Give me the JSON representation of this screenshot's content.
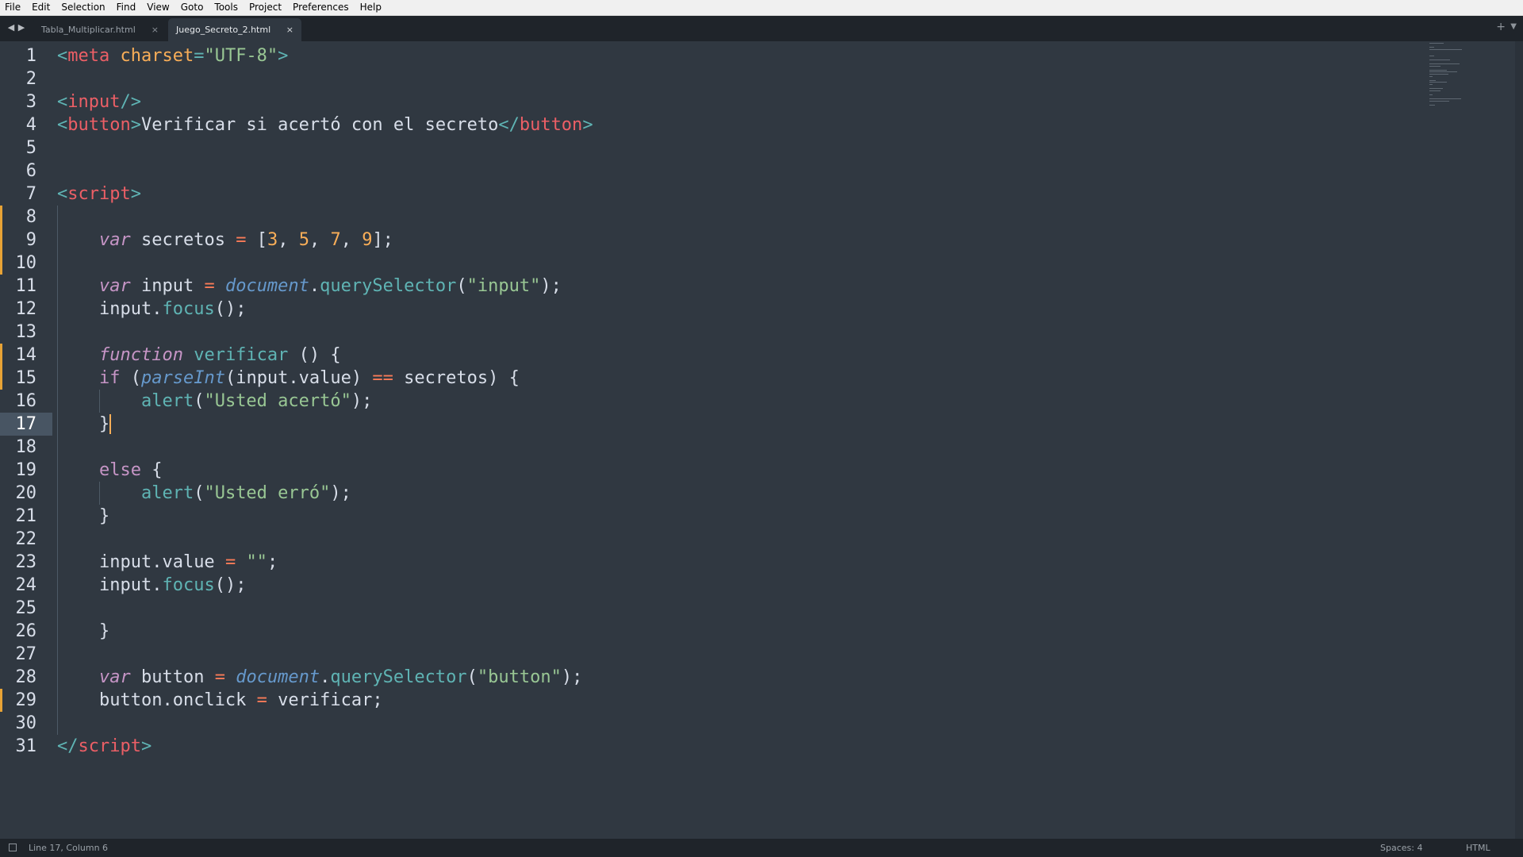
{
  "menu": [
    "File",
    "Edit",
    "Selection",
    "Find",
    "View",
    "Goto",
    "Tools",
    "Project",
    "Preferences",
    "Help"
  ],
  "tabs": [
    {
      "label": "Tabla_Multiplicar.html",
      "active": false
    },
    {
      "label": "Juego_Secreto_2.html",
      "active": true
    }
  ],
  "tab_close_glyph": "×",
  "editor": {
    "current_line": 17,
    "modified_lines": [
      8,
      9,
      10,
      14,
      15,
      29
    ],
    "lines": [
      {
        "n": "1",
        "tokens": [
          [
            "<",
            "punct"
          ],
          [
            "meta",
            "tag"
          ],
          [
            " ",
            "plain"
          ],
          [
            "charset",
            "attr"
          ],
          [
            "=",
            "punct"
          ],
          [
            "\"UTF-8\"",
            "str"
          ],
          [
            ">",
            "punct"
          ]
        ]
      },
      {
        "n": "2",
        "tokens": []
      },
      {
        "n": "3",
        "tokens": [
          [
            "<",
            "punct"
          ],
          [
            "input",
            "tag"
          ],
          [
            "/>",
            "punct"
          ]
        ]
      },
      {
        "n": "4",
        "tokens": [
          [
            "<",
            "punct"
          ],
          [
            "button",
            "tag"
          ],
          [
            ">",
            "punct"
          ],
          [
            "Verificar si acertó con el secreto",
            "text"
          ],
          [
            "</",
            "punct"
          ],
          [
            "button",
            "tag"
          ],
          [
            ">",
            "punct"
          ]
        ]
      },
      {
        "n": "5",
        "tokens": []
      },
      {
        "n": "6",
        "tokens": []
      },
      {
        "n": "7",
        "tokens": [
          [
            "<",
            "punct"
          ],
          [
            "script",
            "tag"
          ],
          [
            ">",
            "punct"
          ]
        ]
      },
      {
        "n": "8",
        "tokens": []
      },
      {
        "n": "9",
        "tokens": [
          [
            "    ",
            "plain"
          ],
          [
            "var",
            "kwi"
          ],
          [
            " secretos ",
            "plain"
          ],
          [
            "=",
            "op"
          ],
          [
            " [",
            "plain"
          ],
          [
            "3",
            "num"
          ],
          [
            ", ",
            "plain"
          ],
          [
            "5",
            "num"
          ],
          [
            ", ",
            "plain"
          ],
          [
            "7",
            "num"
          ],
          [
            ", ",
            "plain"
          ],
          [
            "9",
            "num"
          ],
          [
            "];",
            "plain"
          ]
        ]
      },
      {
        "n": "10",
        "tokens": []
      },
      {
        "n": "11",
        "tokens": [
          [
            "    ",
            "plain"
          ],
          [
            "var",
            "kwi"
          ],
          [
            " input ",
            "plain"
          ],
          [
            "=",
            "op"
          ],
          [
            " ",
            "plain"
          ],
          [
            "document",
            "obj"
          ],
          [
            ".",
            "plain"
          ],
          [
            "querySelector",
            "fn"
          ],
          [
            "(",
            "plain"
          ],
          [
            "\"input\"",
            "str"
          ],
          [
            ");",
            "plain"
          ]
        ]
      },
      {
        "n": "12",
        "tokens": [
          [
            "    ",
            "plain"
          ],
          [
            "input.",
            "plain"
          ],
          [
            "focus",
            "fn"
          ],
          [
            "();",
            "plain"
          ]
        ]
      },
      {
        "n": "13",
        "tokens": []
      },
      {
        "n": "14",
        "tokens": [
          [
            "    ",
            "plain"
          ],
          [
            "function",
            "kwi"
          ],
          [
            " ",
            "plain"
          ],
          [
            "verificar",
            "fn"
          ],
          [
            " () {",
            "plain"
          ]
        ]
      },
      {
        "n": "15",
        "tokens": [
          [
            "    ",
            "plain"
          ],
          [
            "if",
            "kw"
          ],
          [
            " (",
            "plain"
          ],
          [
            "parseInt",
            "obj"
          ],
          [
            "(input.value) ",
            "plain"
          ],
          [
            "==",
            "op"
          ],
          [
            " secretos) {",
            "plain"
          ]
        ]
      },
      {
        "n": "16",
        "tokens": [
          [
            "        ",
            "plain"
          ],
          [
            "alert",
            "fn"
          ],
          [
            "(",
            "plain"
          ],
          [
            "\"Usted acertó\"",
            "str"
          ],
          [
            ");",
            "plain"
          ]
        ]
      },
      {
        "n": "17",
        "tokens": [
          [
            "    }",
            "plain"
          ]
        ]
      },
      {
        "n": "18",
        "tokens": []
      },
      {
        "n": "19",
        "tokens": [
          [
            "    ",
            "plain"
          ],
          [
            "else",
            "kw"
          ],
          [
            " {",
            "plain"
          ]
        ]
      },
      {
        "n": "20",
        "tokens": [
          [
            "        ",
            "plain"
          ],
          [
            "alert",
            "fn"
          ],
          [
            "(",
            "plain"
          ],
          [
            "\"Usted erró\"",
            "str"
          ],
          [
            ");",
            "plain"
          ]
        ]
      },
      {
        "n": "21",
        "tokens": [
          [
            "    }",
            "plain"
          ]
        ]
      },
      {
        "n": "22",
        "tokens": []
      },
      {
        "n": "23",
        "tokens": [
          [
            "    ",
            "plain"
          ],
          [
            "input.value ",
            "plain"
          ],
          [
            "=",
            "op"
          ],
          [
            " ",
            "plain"
          ],
          [
            "\"\"",
            "str"
          ],
          [
            ";",
            "plain"
          ]
        ]
      },
      {
        "n": "24",
        "tokens": [
          [
            "    ",
            "plain"
          ],
          [
            "input.",
            "plain"
          ],
          [
            "focus",
            "fn"
          ],
          [
            "();",
            "plain"
          ]
        ]
      },
      {
        "n": "25",
        "tokens": []
      },
      {
        "n": "26",
        "tokens": [
          [
            "    }",
            "plain"
          ]
        ]
      },
      {
        "n": "27",
        "tokens": []
      },
      {
        "n": "28",
        "tokens": [
          [
            "    ",
            "plain"
          ],
          [
            "var",
            "kwi"
          ],
          [
            " button ",
            "plain"
          ],
          [
            "=",
            "op"
          ],
          [
            " ",
            "plain"
          ],
          [
            "document",
            "obj"
          ],
          [
            ".",
            "plain"
          ],
          [
            "querySelector",
            "fn"
          ],
          [
            "(",
            "plain"
          ],
          [
            "\"button\"",
            "str"
          ],
          [
            ");",
            "plain"
          ]
        ]
      },
      {
        "n": "29",
        "tokens": [
          [
            "    ",
            "plain"
          ],
          [
            "button.onclick ",
            "plain"
          ],
          [
            "=",
            "op"
          ],
          [
            " verificar;",
            "plain"
          ]
        ]
      },
      {
        "n": "30",
        "tokens": []
      },
      {
        "n": "31",
        "tokens": [
          [
            "</",
            "punct"
          ],
          [
            "script",
            "tag"
          ],
          [
            ">",
            "punct"
          ]
        ]
      }
    ]
  },
  "status": {
    "position": "Line 17, Column 6",
    "indentation": "Spaces: 4",
    "syntax": "HTML"
  },
  "colors": {
    "background": "#303841",
    "tag": "#ec5f66",
    "string": "#99c794",
    "keyword": "#c695c6",
    "number": "#f9ae58",
    "function": "#5fb4b4",
    "modified_marker": "#e7a336"
  }
}
